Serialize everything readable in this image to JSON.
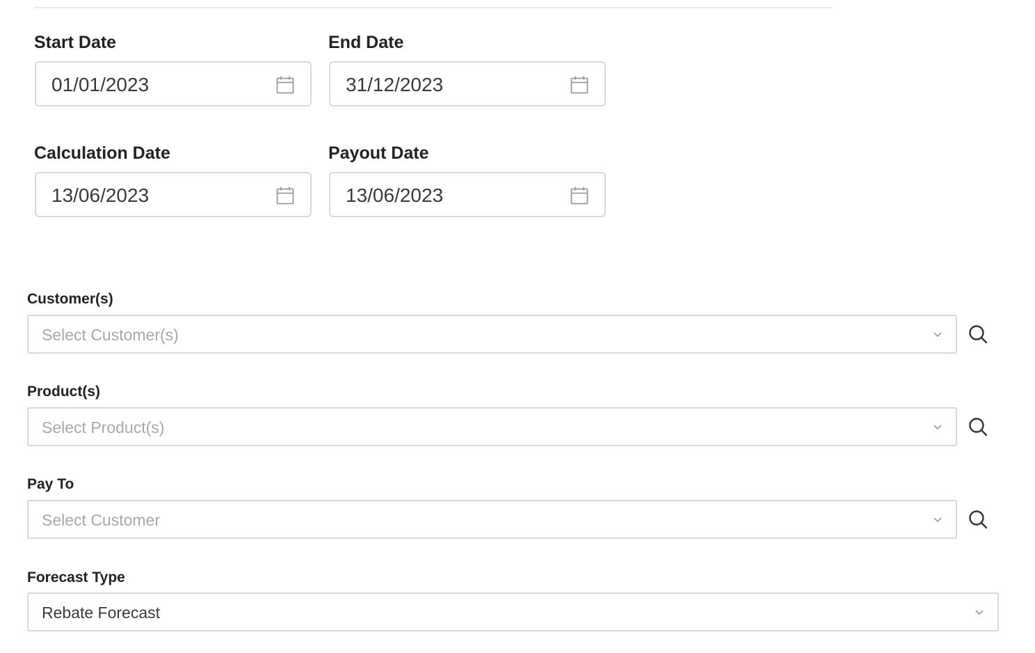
{
  "dates": {
    "start": {
      "label": "Start Date",
      "value": "01/01/2023"
    },
    "end": {
      "label": "End Date",
      "value": "31/12/2023"
    },
    "calculation": {
      "label": "Calculation Date",
      "value": "13/06/2023"
    },
    "payout": {
      "label": "Payout Date",
      "value": "13/06/2023"
    }
  },
  "customers": {
    "label": "Customer(s)",
    "placeholder": "Select Customer(s)"
  },
  "products": {
    "label": "Product(s)",
    "placeholder": "Select Product(s)"
  },
  "pay_to": {
    "label": "Pay To",
    "placeholder": "Select Customer"
  },
  "forecast_type": {
    "label": "Forecast Type",
    "value": "Rebate Forecast"
  },
  "icons": {
    "date": "calendar-icon",
    "dropdown": "chevron-down-icon",
    "lookup": "search-icon"
  },
  "colors": {
    "border": "#d9d9d9",
    "placeholder": "#a8a8a8",
    "text": "#3a3a3a",
    "label": "#222222"
  }
}
